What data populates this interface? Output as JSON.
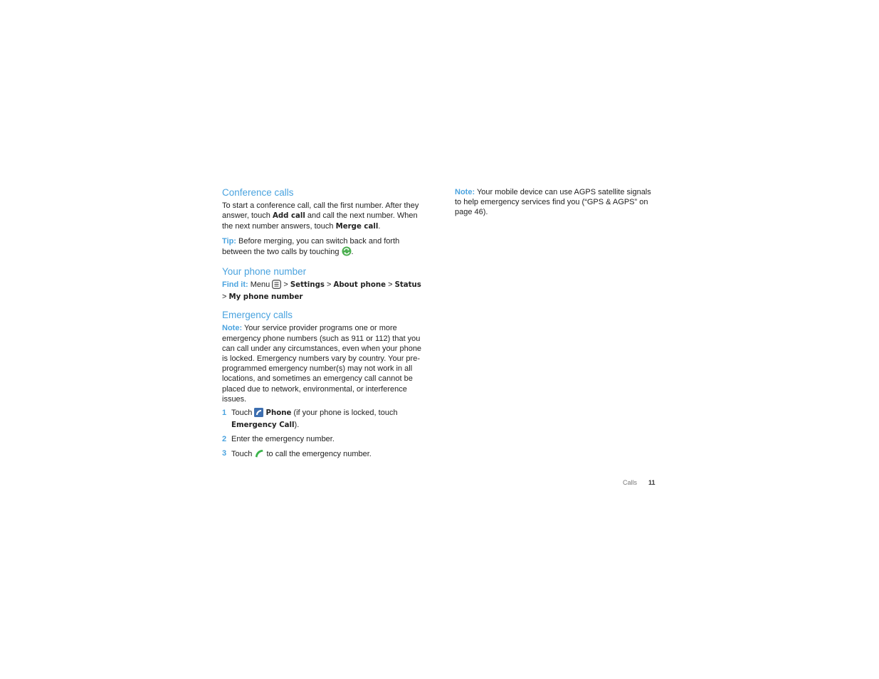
{
  "left": {
    "conference": {
      "title": "Conference calls",
      "p1_a": "To start a conference call, call the first number. After they answer, touch ",
      "p1_b1": "Add call",
      "p1_c": " and call the next number. When the next number answers, touch ",
      "p1_b2": "Merge call",
      "p1_d": ".",
      "tip_label": "Tip:",
      "tip_text": " Before merging, you can switch back and forth between the two calls by touching ",
      "tip_end": ".",
      "icon": "swap-calls-icon"
    },
    "phone_number": {
      "title": "Your phone number",
      "find_label": "Find it:",
      "menu": " Menu ",
      "sep": " > ",
      "path": [
        "Settings",
        "About phone",
        "Status",
        "My phone number"
      ]
    },
    "emergency": {
      "title": "Emergency calls",
      "note_label": "Note:",
      "note_text": " Your service provider programs one or more emergency phone numbers (such as 911 or 112) that you can call under any circumstances, even when your phone is locked. Emergency numbers vary by country. Your pre-programmed emergency number(s) may not work in all locations, and sometimes an emergency call cannot be placed due to network, environmental, or interference issues.",
      "steps": [
        {
          "num": "1",
          "a": "Touch ",
          "b": "Phone",
          "c": " (if your phone is locked, touch ",
          "d": "Emergency Call",
          "e": ")."
        },
        {
          "num": "2",
          "text": "Enter the emergency number."
        },
        {
          "num": "3",
          "a": "Touch ",
          "c": " to call the emergency number."
        }
      ]
    }
  },
  "right": {
    "note_label": "Note:",
    "note_text": " Your mobile device can use AGPS satellite signals to help emergency services find you (“GPS & AGPS” on page 46)."
  },
  "footer": {
    "section": "Calls",
    "page": "11"
  }
}
